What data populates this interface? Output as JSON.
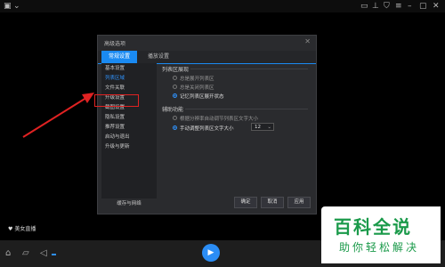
{
  "dialog": {
    "title": "高级选项",
    "close_glyph": "✕",
    "tabs": [
      {
        "label": "常规设置",
        "active": true
      },
      {
        "label": "播放设置",
        "active": false
      }
    ],
    "sidebar": {
      "items": [
        {
          "label": "基本设置",
          "selected": false
        },
        {
          "label": "列表区域",
          "selected": true
        },
        {
          "label": "文件关联",
          "selected": false
        },
        {
          "label": "升级设置",
          "selected": false
        },
        {
          "label": "截图设置",
          "selected": false
        },
        {
          "label": "隐私设置",
          "selected": false
        },
        {
          "label": "推荐设置",
          "selected": false
        },
        {
          "label": "启动与退出",
          "selected": false
        },
        {
          "label": "升级与更新",
          "selected": false
        }
      ],
      "footer": "缓存与网络"
    },
    "section1": {
      "title": "列表区展现",
      "options": [
        "总是展开列表区",
        "总是关闭列表区",
        "记忆列表区展开状态"
      ],
      "selected_index": 2
    },
    "section2": {
      "title": "辅助功能",
      "options": [
        "根据分辨率自动调节列表区文字大小",
        "手动调整列表区文字大小"
      ],
      "selected_index": 1,
      "font_size_value": "12"
    },
    "buttons": {
      "ok": "确定",
      "cancel": "取消",
      "apply": "应用"
    }
  },
  "bottom_left_label": "美女直播",
  "watermark": {
    "line1": "百科全说",
    "line2": "助你轻松解决"
  },
  "colors": {
    "accent": "#1a8af2",
    "highlight": "#e02222",
    "watermark": "#1a9a4a"
  },
  "icons": [
    "app-logo-icon",
    "chevron-down-icon",
    "monitor-icon",
    "pin-icon",
    "skin-icon",
    "menu-icon",
    "minimize-icon",
    "maximize-icon",
    "close-icon",
    "toolbox-icon",
    "folder-icon",
    "volume-icon",
    "play-icon"
  ]
}
